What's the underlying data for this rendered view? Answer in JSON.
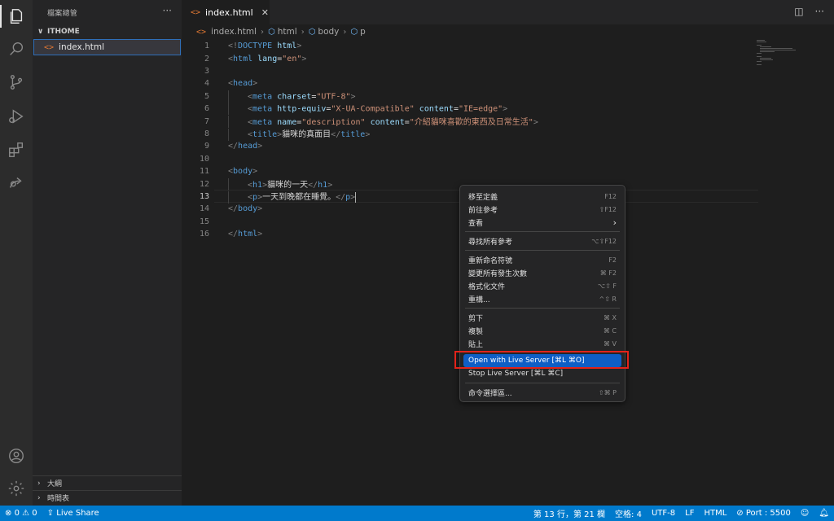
{
  "sidebar": {
    "title": "檔案總管",
    "folder": "ITHOME",
    "file": "index.html",
    "panels": [
      "大綱",
      "時間表"
    ]
  },
  "tab": {
    "label": "index.html"
  },
  "breadcrumb": [
    "index.html",
    "html",
    "body",
    "p"
  ],
  "editor": {
    "line_numbers": [
      "1",
      "2",
      "3",
      "4",
      "5",
      "6",
      "7",
      "8",
      "9",
      "10",
      "11",
      "12",
      "13",
      "14",
      "15",
      "16"
    ],
    "current_line": 13
  },
  "context_menu": {
    "items": [
      {
        "label": "移至定義",
        "key": "F12"
      },
      {
        "label": "前往參考",
        "key": "⇧F12"
      },
      {
        "label": "查看",
        "key": "›"
      },
      {
        "label": "尋找所有參考",
        "key": "⌥⇧F12"
      },
      {
        "label": "重新命名符號",
        "key": "F2"
      },
      {
        "label": "變更所有發生次數",
        "key": "⌘ F2"
      },
      {
        "label": "格式化文件",
        "key": "⌥⇧ F"
      },
      {
        "label": "重構...",
        "key": "^⇧ R"
      },
      {
        "label": "剪下",
        "key": "⌘ X"
      },
      {
        "label": "複製",
        "key": "⌘ C"
      },
      {
        "label": "貼上",
        "key": "⌘ V"
      },
      {
        "label": "Open with Live Server [⌘L ⌘O]",
        "key": ""
      },
      {
        "label": "Stop Live Server [⌘L ⌘C]",
        "key": ""
      },
      {
        "label": "命令選擇區...",
        "key": "⇧⌘ P"
      }
    ]
  },
  "status": {
    "errors": "0",
    "warnings": "0",
    "live_share": "Live Share",
    "position": "第 13 行，第 21 欄",
    "spaces": "空格: 4",
    "encoding": "UTF-8",
    "eol": "LF",
    "language": "HTML",
    "port": "Port : 5500"
  },
  "colors": {
    "status_bar": "#007acc",
    "menu_highlight": "#0e5ec5",
    "highlight_outline": "#e2231a"
  }
}
